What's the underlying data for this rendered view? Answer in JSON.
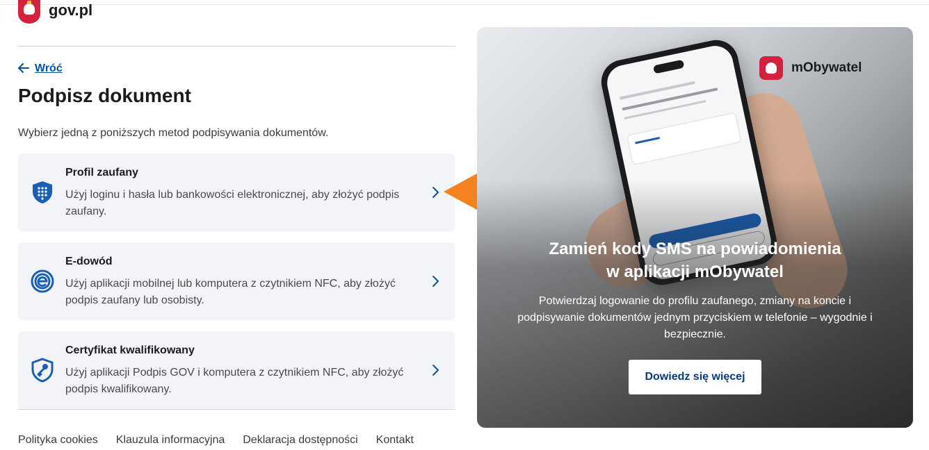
{
  "header": {
    "logo_text": "gov.pl"
  },
  "back": {
    "label": "Wróć"
  },
  "page": {
    "title": "Podpisz dokument",
    "intro": "Wybierz jedną z poniższych metod podpisywania dokumentów."
  },
  "methods": [
    {
      "title": "Profil zaufany",
      "description": "Użyj loginu i hasła lub bankowości elektronicznej, aby złożyć podpis zaufany.",
      "icon": "shield-keypad-icon"
    },
    {
      "title": "E-dowód",
      "description": "Użyj aplikacji mobilnej lub komputera z czytnikiem NFC, aby złożyć podpis zaufany lub osobisty.",
      "icon": "e-id-icon"
    },
    {
      "title": "Certyfikat kwalifikowany",
      "description": "Użyj aplikacji Podpis GOV i komputera z czytnikiem NFC, aby złożyć podpis kwalifikowany.",
      "icon": "shield-key-icon"
    }
  ],
  "footer": {
    "links": [
      "Polityka cookies",
      "Klauzula informacyjna",
      "Deklaracja dostępności",
      "Kontakt"
    ]
  },
  "promo": {
    "brand": "mObywatel",
    "title_line1": "Zamień kody SMS na powiadomienia",
    "title_line2": "w aplikacji mObywatel",
    "text": "Potwierdzaj logowanie do profilu zaufanego, zmiany na koncie i podpisywanie dokumentów jednym przyciskiem w telefonie – wygodnie i bezpiecznie.",
    "button": "Dowiedz się więcej"
  },
  "colors": {
    "link_blue": "#0052a5",
    "card_bg": "#f2f4f8",
    "gov_red": "#d4213d",
    "annotation_orange": "#f58220",
    "promo_button_text": "#0b3a78"
  }
}
